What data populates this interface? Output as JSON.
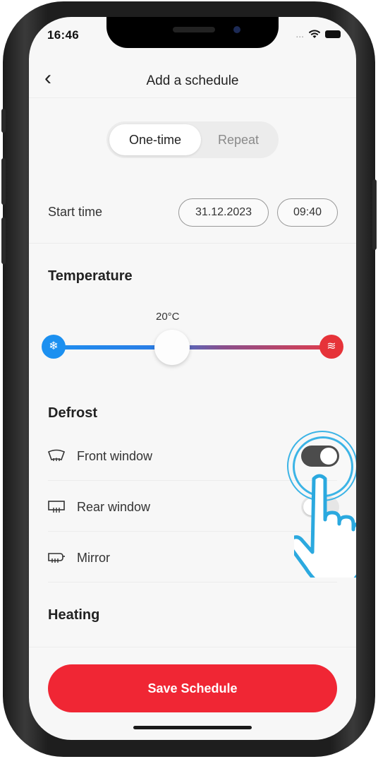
{
  "status_bar": {
    "time": "16:46",
    "signal": "...",
    "wifi_icon": "wifi-icon",
    "battery_icon": "battery-icon"
  },
  "header": {
    "back_icon": "chevron-left-icon",
    "back_glyph": "‹",
    "title": "Add a schedule"
  },
  "segment": {
    "options": [
      "One-time",
      "Repeat"
    ],
    "selected": "One-time"
  },
  "start_time": {
    "label": "Start time",
    "date": "31.12.2023",
    "time": "09:40"
  },
  "temperature": {
    "title": "Temperature",
    "value_label": "20°C",
    "cold_icon": "snowflake-icon",
    "cold_glyph": "❄",
    "heat_icon": "heat-waves-icon",
    "heat_glyph": "≋"
  },
  "defrost": {
    "title": "Defrost",
    "items": [
      {
        "label": "Front window",
        "icon": "front-window-defrost-icon",
        "enabled": true
      },
      {
        "label": "Rear window",
        "icon": "rear-window-defrost-icon",
        "enabled": false
      },
      {
        "label": "Mirror",
        "icon": "mirror-defrost-icon",
        "enabled": true
      }
    ]
  },
  "heating": {
    "title": "Heating"
  },
  "save_button": {
    "label": "Save Schedule"
  },
  "colors": {
    "accent_red": "#f02634",
    "cold_blue": "#1c90f0",
    "hot_red": "#e63339",
    "tap_ring": "#3cb4e6",
    "toggle_on": "#2d2d2d"
  }
}
